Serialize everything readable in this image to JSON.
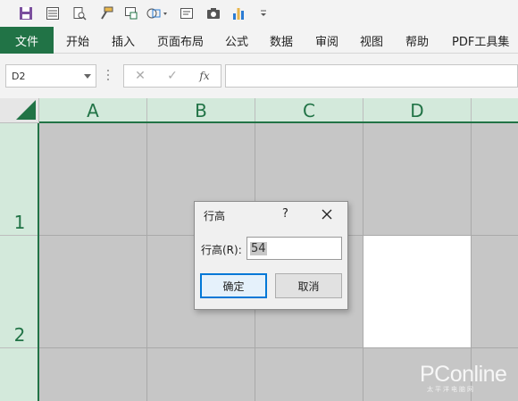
{
  "colors": {
    "brand": "#217346",
    "header_bg": "#d3e9db",
    "selection_gray": "#c6c6c6",
    "dialog_ok_border": "#0078d7"
  },
  "qat": {
    "icons": [
      "save-icon",
      "form-icon",
      "print-preview-icon",
      "format-painter-icon",
      "screen-clip-icon",
      "shapes-icon",
      "text-box-icon",
      "camera-icon",
      "chart-icon",
      "customize-icon"
    ]
  },
  "ribbon": {
    "tabs": [
      "文件",
      "开始",
      "插入",
      "页面布局",
      "公式",
      "数据",
      "审阅",
      "视图",
      "帮助",
      "PDF工具集"
    ]
  },
  "formula_bar": {
    "name_box": "D2",
    "fx_label": "fx",
    "cancel_glyph": "✕",
    "enter_glyph": "✓",
    "value": ""
  },
  "grid": {
    "columns": [
      "A",
      "B",
      "C",
      "D"
    ],
    "rows": [
      "1",
      "2"
    ],
    "active_cell": "D2"
  },
  "dialog": {
    "title": "行高",
    "help": "?",
    "field_label": "行高(R):",
    "field_value": "54",
    "ok_label": "确定",
    "cancel_label": "取消"
  },
  "watermark": {
    "brand": "PConline",
    "tagline": "太平洋电脑网"
  }
}
